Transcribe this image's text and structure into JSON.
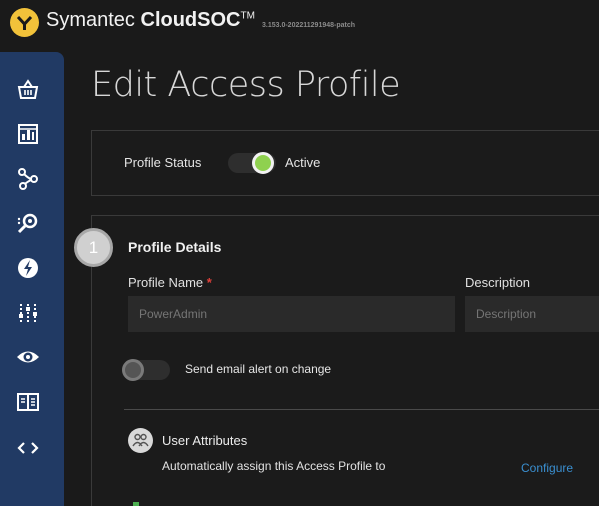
{
  "header": {
    "brand_prefix": "Symantec",
    "brand_name": "CloudSOC",
    "brand_tm": "TM",
    "version": "3.153.0-202211291948-patch",
    "logo_icon": "symantec-logo-icon",
    "logo_color": "#f2c23a"
  },
  "sidebar": {
    "background": "#213a64",
    "items": [
      {
        "icon": "basket-icon"
      },
      {
        "icon": "dashboard-chart-icon"
      },
      {
        "icon": "cloud-network-icon"
      },
      {
        "icon": "investigate-search-icon"
      },
      {
        "icon": "lightning-icon"
      },
      {
        "icon": "sliders-icon"
      },
      {
        "icon": "eye-icon"
      },
      {
        "icon": "book-icon"
      },
      {
        "icon": "code-brackets-icon"
      }
    ]
  },
  "page": {
    "title": "Edit Access Profile"
  },
  "status": {
    "label": "Profile Status",
    "value": "Active",
    "enabled": true,
    "toggle_color": "#8fd14f"
  },
  "details": {
    "step_number": "1",
    "title": "Profile Details",
    "profile_name_label": "Profile Name",
    "required_marker": "*",
    "profile_name_placeholder": "PowerAdmin",
    "description_label": "Description",
    "description_placeholder": "Description",
    "email_alert_label": "Send email alert on change",
    "email_alert_enabled": false
  },
  "user_attributes": {
    "title": "User Attributes",
    "description": "Automatically assign this Access Profile to",
    "configure_label": "Configure",
    "link_color": "#3a8fd0"
  }
}
